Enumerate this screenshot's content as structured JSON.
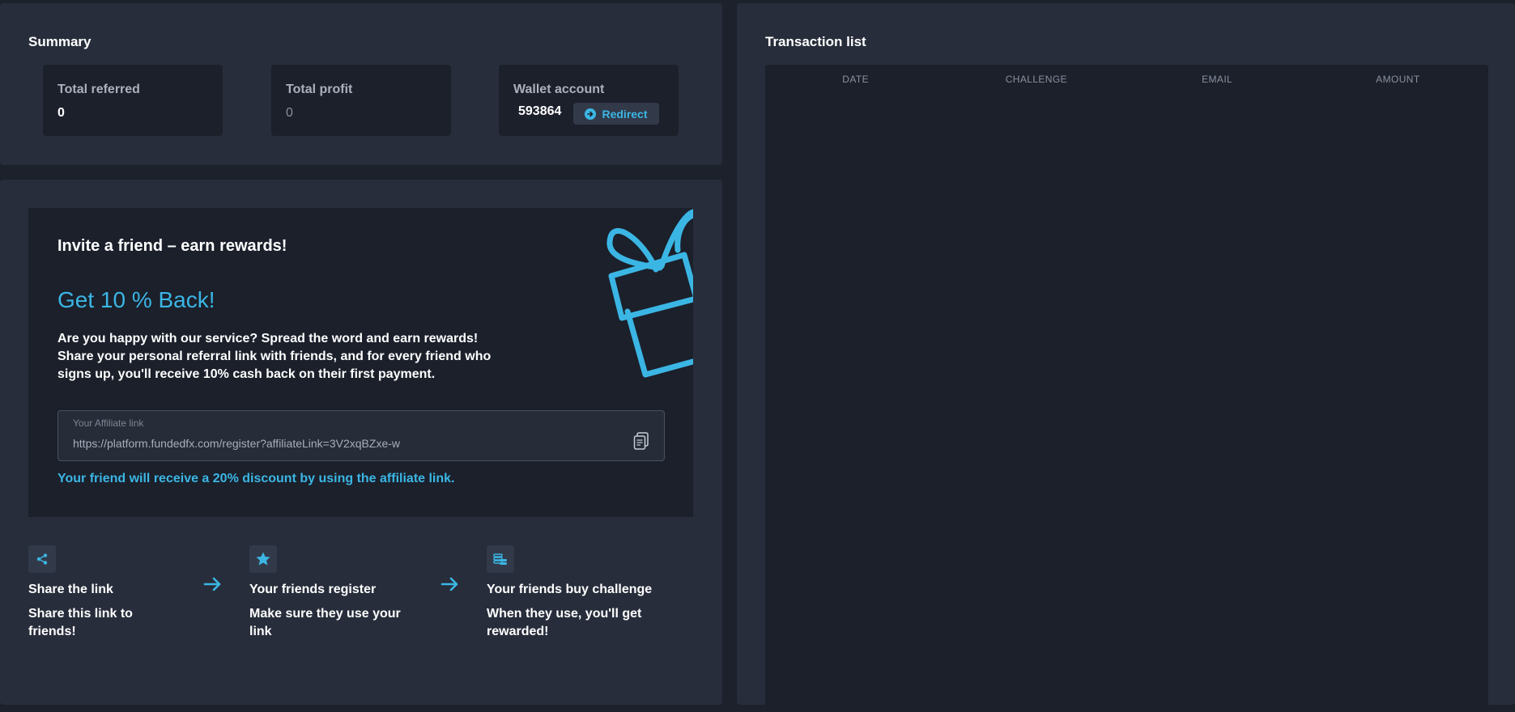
{
  "summary": {
    "title": "Summary",
    "total_referred": {
      "label": "Total referred",
      "value": "0"
    },
    "total_profit": {
      "label": "Total profit",
      "value": "0"
    },
    "wallet": {
      "label": "Wallet account",
      "value": "593864",
      "button_label": "Redirect",
      "button_icon": "arrow-right-circle-icon"
    }
  },
  "invite": {
    "heading": "Invite a friend – earn rewards!",
    "cashback_title": "Get 10 % Back!",
    "description": "Are you happy with our service? Spread the word and earn rewards! Share your personal referral link with friends, and for every friend who signs up, you'll receive 10% cash back on their first payment.",
    "affiliate": {
      "label": "Your Affiliate link",
      "value": "https://platform.fundedfx.com/register?affiliateLink=3V2xqBZxe-w",
      "copy_icon": "copy-icon"
    },
    "discount_note": "Your friend will receive a 20% discount by using the affiliate link.",
    "decoration_icon": "gift-icon"
  },
  "steps": [
    {
      "icon": "share-icon",
      "title": "Share the link",
      "desc": "Share this link to friends!"
    },
    {
      "icon": "star-icon",
      "title": "Your friends register",
      "desc": "Make sure they use your link"
    },
    {
      "icon": "coins-icon",
      "title": "Your friends buy challenge",
      "desc": "When they use, you'll get rewarded!"
    }
  ],
  "transactions": {
    "title": "Transaction list",
    "columns": [
      "DATE",
      "CHALLENGE",
      "EMAIL",
      "AMOUNT"
    ],
    "rows": []
  },
  "colors": {
    "accent": "#3bb6e4",
    "panel": "#272d3b",
    "card": "#1b202b",
    "background": "#1c212c"
  }
}
